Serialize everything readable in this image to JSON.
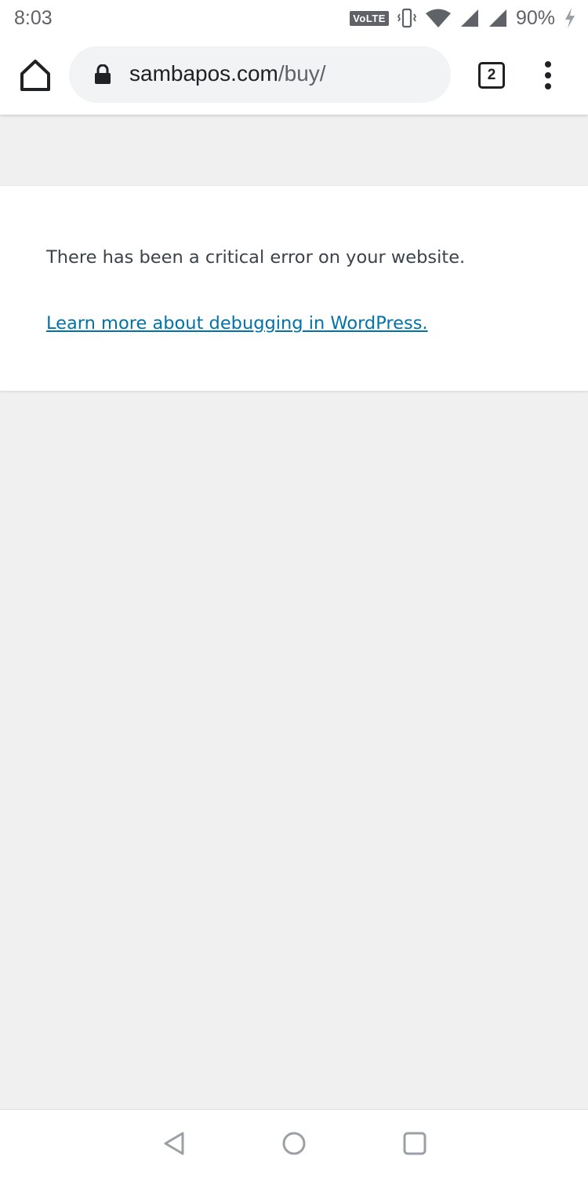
{
  "status_bar": {
    "time": "8:03",
    "network_badge": "VoLTE",
    "battery": "90%",
    "icons": [
      "volte-icon",
      "vibrate-icon",
      "wifi-icon",
      "signal-icon",
      "signal-icon",
      "charging-icon"
    ]
  },
  "toolbar": {
    "url_host": "sambapos.com",
    "url_path": "/buy/",
    "tab_count": "2",
    "icons": [
      "home-icon",
      "lock-icon",
      "tabs-icon",
      "more-vert-icon"
    ]
  },
  "error": {
    "message": "There has been a critical error on your website.",
    "link_text": "Learn more about debugging in WordPress."
  },
  "nav_bar": {
    "icons": [
      "back-icon",
      "home-circle-icon",
      "recents-icon"
    ]
  },
  "colors": {
    "page_bg": "#f0f0f1",
    "link": "#0073aa",
    "text": "#3c434a"
  }
}
